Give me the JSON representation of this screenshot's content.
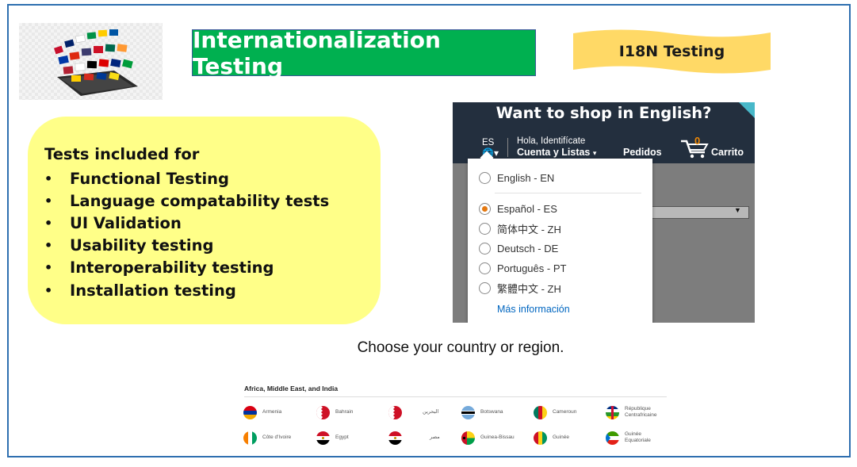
{
  "title": "Internationalization Testing",
  "banner": "I18N Testing",
  "tests": {
    "heading": "Tests included for",
    "bullet": "•",
    "items": [
      "Functional Testing",
      "Language compatability tests",
      "UI Validation",
      "Usability testing",
      "Interoperability testing",
      "Installation testing"
    ]
  },
  "amazon": {
    "prompt": "Want to shop in English?",
    "lang_code": "ES",
    "greeting": "Hola, Identifícate",
    "account": "Cuenta y Listas",
    "orders": "Pedidos",
    "cart_count": "0",
    "cart": "Carrito",
    "languages": [
      {
        "label": "English - EN",
        "selected": false
      },
      {
        "label": "Español - ES",
        "selected": true
      },
      {
        "label": "简体中文 - ZH",
        "selected": false
      },
      {
        "label": "Deutsch - DE",
        "selected": false
      },
      {
        "label": "Português - PT",
        "selected": false
      },
      {
        "label": "繁體中文 - ZH",
        "selected": false
      }
    ],
    "more_info": "Más información"
  },
  "region": {
    "heading": "Choose your country or region.",
    "section": "Africa, Middle East, and India",
    "countries": [
      {
        "name": "Armenia",
        "flag": "armenia"
      },
      {
        "name": "Bahrain",
        "flag": "bahrain"
      },
      {
        "name": "البحرين",
        "flag": "bahrain"
      },
      {
        "name": "Botswana",
        "flag": "botswana"
      },
      {
        "name": "Cameroun",
        "flag": "cameroon"
      },
      {
        "name": "République Centrafricaine",
        "flag": "car"
      },
      {
        "name": "Côte d'Ivoire",
        "flag": "ivorycoast"
      },
      {
        "name": "Egypt",
        "flag": "egypt"
      },
      {
        "name": "مصر",
        "flag": "egypt"
      },
      {
        "name": "Guinea-Bissau",
        "flag": "guineabissau"
      },
      {
        "name": "Guinée",
        "flag": "guinea"
      },
      {
        "name": "Guinée Equatoriale",
        "flag": "eqguinea"
      }
    ]
  },
  "colors": {
    "title_bg": "#00b050",
    "banner_bg": "#ffd966",
    "tests_bg": "#ffff88",
    "frame_border": "#2e6fb0",
    "amazon_navy": "#232f3e",
    "amazon_orange": "#e47911",
    "link_blue": "#0066c0"
  }
}
